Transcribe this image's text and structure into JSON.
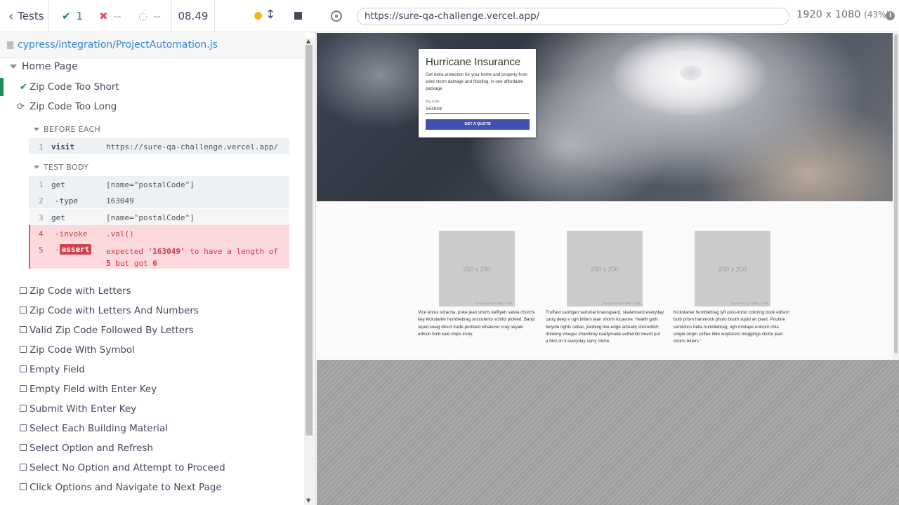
{
  "reporter": {
    "tests_label": "Tests",
    "passed_count": "1",
    "failed_count": "--",
    "pending_count": "--",
    "duration": "08.49",
    "spec_path": "cypress/integration/ProjectAutomation.js"
  },
  "suite": {
    "title": "Home Page",
    "tests": [
      {
        "label": "Zip Code Too Short",
        "state": "passed"
      },
      {
        "label": "Zip Code Too Long",
        "state": "running"
      },
      {
        "label": "Zip Code with Letters",
        "state": "pending"
      },
      {
        "label": "Zip Code with Letters And Numbers",
        "state": "pending"
      },
      {
        "label": "Valid Zip Code Followed By Letters",
        "state": "pending"
      },
      {
        "label": "Zip Code With Symbol",
        "state": "pending"
      },
      {
        "label": "Empty Field",
        "state": "pending"
      },
      {
        "label": "Empty Field with Enter Key",
        "state": "pending"
      },
      {
        "label": "Submit With Enter Key",
        "state": "pending"
      },
      {
        "label": "Select Each Building Material",
        "state": "pending"
      },
      {
        "label": "Select Option and Refresh",
        "state": "pending"
      },
      {
        "label": "Select No Option and Attempt to Proceed",
        "state": "pending"
      },
      {
        "label": "Click Options and Navigate to Next Page",
        "state": "pending"
      }
    ]
  },
  "hooks": {
    "before_each_title": "BEFORE EACH",
    "before_each_cmds": [
      {
        "num": "1",
        "method": "visit",
        "arg": "https://sure-qa-challenge.vercel.app/"
      }
    ],
    "test_body_title": "TEST BODY",
    "test_body_cmds": [
      {
        "num": "1",
        "method": "get",
        "arg": "[name=\"postalCode\"]"
      },
      {
        "num": "2",
        "method": "-type",
        "arg": "163049"
      },
      {
        "num": "3",
        "method": "get",
        "arg": "[name=\"postalCode\"]"
      },
      {
        "num": "4",
        "method": "-invoke",
        "arg": ".val()"
      },
      {
        "num": "5",
        "method": "assert",
        "dash": "-",
        "arg_line1_a": "expected ",
        "arg_line1_b": "'163049'",
        "arg_line1_c": " to have a length of",
        "arg_line2_a": "5",
        "arg_line2_b": " but got ",
        "arg_line2_c": "6"
      }
    ]
  },
  "aut": {
    "url": "https://sure-qa-challenge.vercel.app/",
    "viewport": "1920 x 1080",
    "scale": "(43%)",
    "info_icon": "i",
    "hero": {
      "title": "Hurricane Insurance",
      "description": "Get extra protection for your home and property from wind storm damage and flooding, in one affordable package.",
      "zip_label": "Zip code",
      "zip_value": "163049",
      "button_label": "GET A QUOTE"
    },
    "features": [
      {
        "image_label": "250 x 250",
        "powered": "Powered by HTML.COM",
        "text": "Vice ennui sriracha, poke jean shorts keffiyeh salvia church-key kickstarter humblebrag succulents schlitz pickled. Banjo squid swag direct trade portland whatever cray taiyaki edison bulb kale chips irony."
      },
      {
        "image_label": "250 x 250",
        "powered": "Powered by HTML.COM",
        "text": "Truffaut cardigan sartorial knausgaard, skateboard everyday carry deep v ugh bitters jean shorts locavore. Health goth bicycle rights celiac, jianbing live-edge actually shoreditch drinking vinegar chambray readymade authentic beard put a bird on it everyday carry cliche."
      },
      {
        "image_label": "250 x 250",
        "powered": "Powered by HTML.COM",
        "text": "Kickstarter humblebrag lyft post-ironic coloring book edison bulb prism hammock photo booth squid air plant. Poutine semiotics hella humblebrag, ugh mixtape unicorn chia single-origin coffee tilde wayfarers meggings cliche jean shorts bitters.\""
      }
    ]
  },
  "colors": {
    "pass": "#1f8a5b",
    "fail": "#e94f5f",
    "running": "#f5b521",
    "link": "#3386d4",
    "button": "#3f51b5"
  }
}
